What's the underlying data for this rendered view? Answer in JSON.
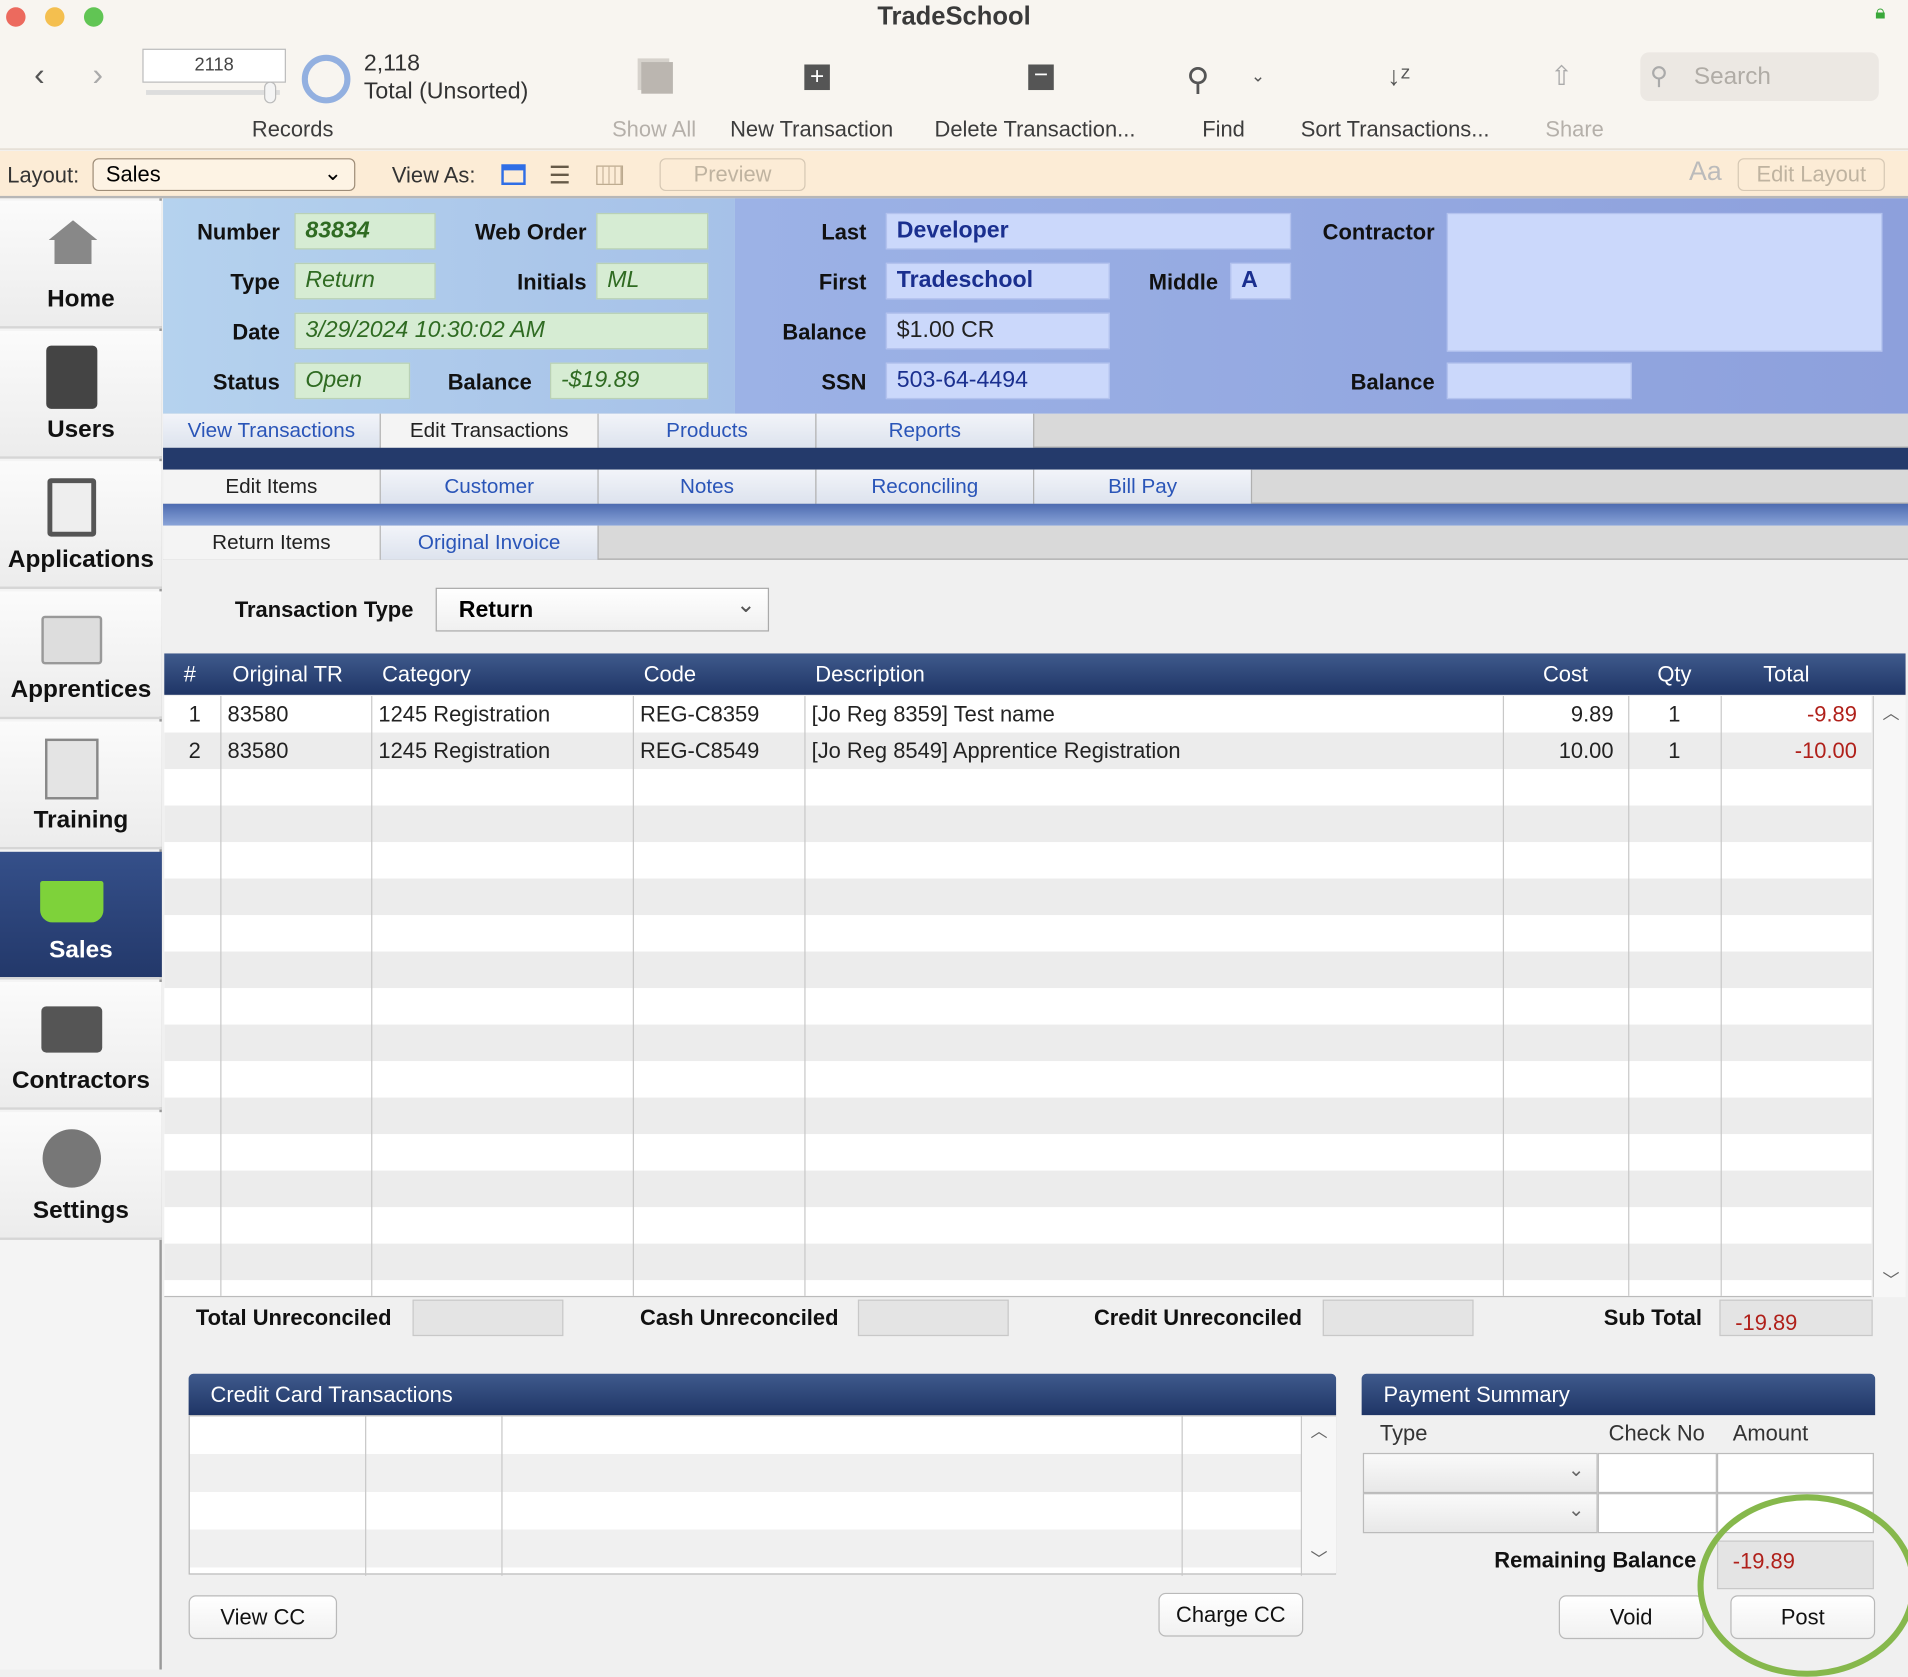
{
  "window": {
    "title": "TradeSchool"
  },
  "toolbar": {
    "record_field": "2118",
    "record_count": "2,118",
    "record_status": "Total (Unsorted)",
    "records_label": "Records",
    "show_all": "Show All",
    "new_transaction": "New Transaction",
    "delete_transaction": "Delete Transaction...",
    "find": "Find",
    "sort": "Sort Transactions...",
    "share": "Share",
    "search_placeholder": "Search"
  },
  "layoutbar": {
    "layout_label": "Layout:",
    "layout_value": "Sales",
    "view_as_label": "View As:",
    "preview": "Preview",
    "edit_layout": "Edit Layout",
    "text_size_icon": "Aa"
  },
  "sidebar": {
    "items": [
      {
        "label": "Home",
        "icon": "house-icon"
      },
      {
        "label": "Users",
        "icon": "address-book-icon"
      },
      {
        "label": "Applications",
        "icon": "clipboard-icon"
      },
      {
        "label": "Apprentices",
        "icon": "id-card-icon"
      },
      {
        "label": "Training",
        "icon": "certificate-icon"
      },
      {
        "label": "Sales",
        "icon": "basket-icon",
        "selected": true
      },
      {
        "label": "Contractors",
        "icon": "briefcase-icon"
      },
      {
        "label": "Settings",
        "icon": "wrench-icon"
      }
    ]
  },
  "header": {
    "number_label": "Number",
    "number": "83834",
    "web_order_label": "Web Order",
    "web_order": "",
    "type_label": "Type",
    "type": "Return",
    "initials_label": "Initials",
    "initials": "ML",
    "date_label": "Date",
    "date": "3/29/2024 10:30:02 AM",
    "status_label": "Status",
    "status": "Open",
    "balance_label": "Balance",
    "balance": "-$19.89",
    "last_label": "Last",
    "last": "Developer",
    "first_label": "First",
    "first": "Tradeschool",
    "middle_label": "Middle",
    "middle": "A",
    "cust_balance_label": "Balance",
    "cust_balance": "$1.00 CR",
    "ssn_label": "SSN",
    "ssn": "503-64-4494",
    "contractor_label": "Contractor",
    "contractor": "",
    "contractor_balance_label": "Balance",
    "contractor_balance": ""
  },
  "tabs1": [
    "View Transactions",
    "Edit Transactions",
    "Products",
    "Reports"
  ],
  "tabs2": [
    "Edit Items",
    "Customer",
    "Notes",
    "Reconciling",
    "Bill Pay"
  ],
  "tabs3": [
    "Return Items",
    "Original Invoice"
  ],
  "transaction_type": {
    "label": "Transaction Type",
    "value": "Return"
  },
  "table": {
    "columns": [
      "#",
      "Original TR",
      "Category",
      "Code",
      "Description",
      "Cost",
      "Qty",
      "Total"
    ],
    "rows": [
      {
        "n": "1",
        "orig": "83580",
        "category": "1245 Registration",
        "code": "REG-C8359",
        "description": "[Jo Reg 8359] Test name",
        "cost": "9.89",
        "qty": "1",
        "total": "-9.89"
      },
      {
        "n": "2",
        "orig": "83580",
        "category": "1245 Registration",
        "code": "REG-C8549",
        "description": "[Jo Reg 8549] Apprentice Registration",
        "cost": "10.00",
        "qty": "1",
        "total": "-10.00"
      }
    ]
  },
  "totals": {
    "total_unreconciled_label": "Total Unreconciled",
    "cash_unreconciled_label": "Cash Unreconciled",
    "credit_unreconciled_label": "Credit Unreconciled",
    "sub_total_label": "Sub Total",
    "sub_total": "-19.89"
  },
  "cc": {
    "title": "Credit Card Transactions",
    "view_cc": "View CC",
    "charge_cc": "Charge CC"
  },
  "payment": {
    "title": "Payment Summary",
    "col_type": "Type",
    "col_check": "Check No",
    "col_amount": "Amount",
    "remaining_label": "Remaining Balance",
    "remaining": "-19.89",
    "void": "Void",
    "post": "Post"
  },
  "colors": {
    "accent_navy": "#23386a",
    "negative": "#b0201a",
    "highlight_circle": "#86b84c"
  }
}
